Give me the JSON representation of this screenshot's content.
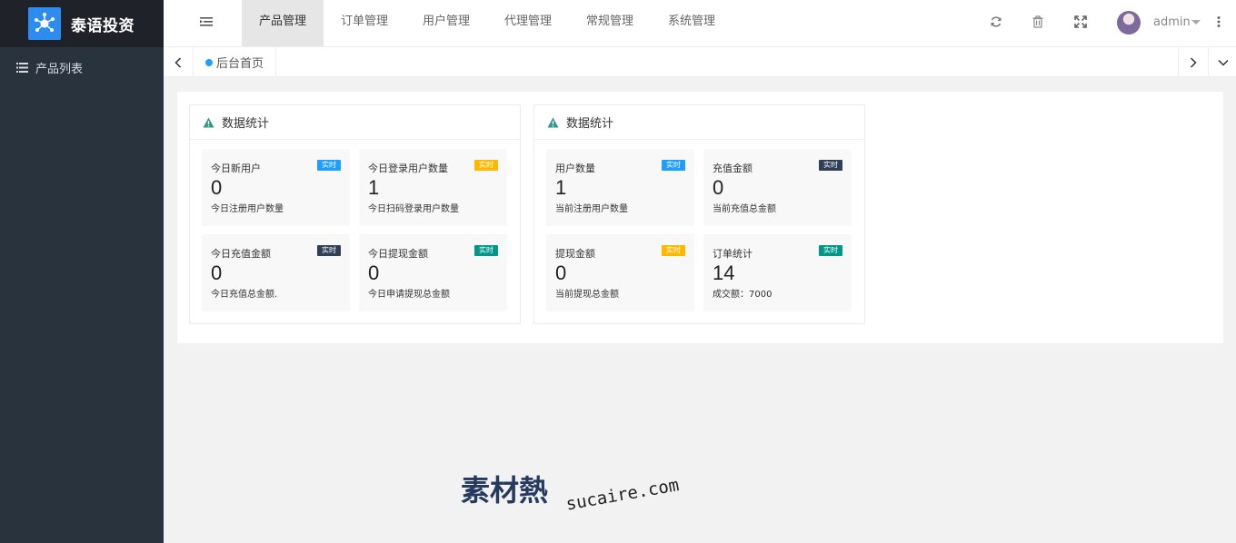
{
  "app": {
    "title": "泰语投资"
  },
  "sidebar": {
    "items": [
      {
        "label": "产品列表",
        "icon": "list-icon"
      }
    ]
  },
  "header": {
    "nav": [
      {
        "label": "产品管理",
        "active": true
      },
      {
        "label": "订单管理",
        "active": false
      },
      {
        "label": "用户管理",
        "active": false
      },
      {
        "label": "代理管理",
        "active": false
      },
      {
        "label": "常规管理",
        "active": false
      },
      {
        "label": "系统管理",
        "active": false
      }
    ],
    "icons": [
      "refresh-icon",
      "trash-icon",
      "fullscreen-icon",
      "more-vertical-icon"
    ],
    "user": "admin"
  },
  "tabs": {
    "home": "后台首页"
  },
  "colors": {
    "blue": "#1e9fff",
    "yellow": "#ffb800",
    "dark": "#2f4056",
    "teal": "#009688"
  },
  "cards": [
    {
      "title": "数据统计",
      "tiles": [
        {
          "label": "今日新用户",
          "value": "0",
          "desc": "今日注册用户数量",
          "badge": "实时",
          "badge_color": "#1e9fff"
        },
        {
          "label": "今日登录用户数量",
          "value": "1",
          "desc": "今日扫码登录用户数量",
          "badge": "实时",
          "badge_color": "#ffb800"
        },
        {
          "label": "今日充值金额",
          "value": "0",
          "desc": "今日充值总金额.",
          "badge": "实时",
          "badge_color": "#2f4056"
        },
        {
          "label": "今日提现金额",
          "value": "0",
          "desc": "今日申请提现总金额",
          "badge": "实时",
          "badge_color": "#009688"
        }
      ]
    },
    {
      "title": "数据统计",
      "tiles": [
        {
          "label": "用户数量",
          "value": "1",
          "desc": "当前注册用户数量",
          "badge": "实时",
          "badge_color": "#1e9fff"
        },
        {
          "label": "充值金额",
          "value": "0",
          "desc": "当前充值总金额",
          "badge": "实时",
          "badge_color": "#2f4056"
        },
        {
          "label": "提现金额",
          "value": "0",
          "desc": "当前提现总金额",
          "badge": "实时",
          "badge_color": "#ffb800"
        },
        {
          "label": "订单统计",
          "value": "14",
          "desc": "成交额：7000",
          "badge": "实时",
          "badge_color": "#009688"
        }
      ]
    }
  ],
  "watermark": {
    "logo": "素材熱",
    "url": "sucaire.com"
  }
}
